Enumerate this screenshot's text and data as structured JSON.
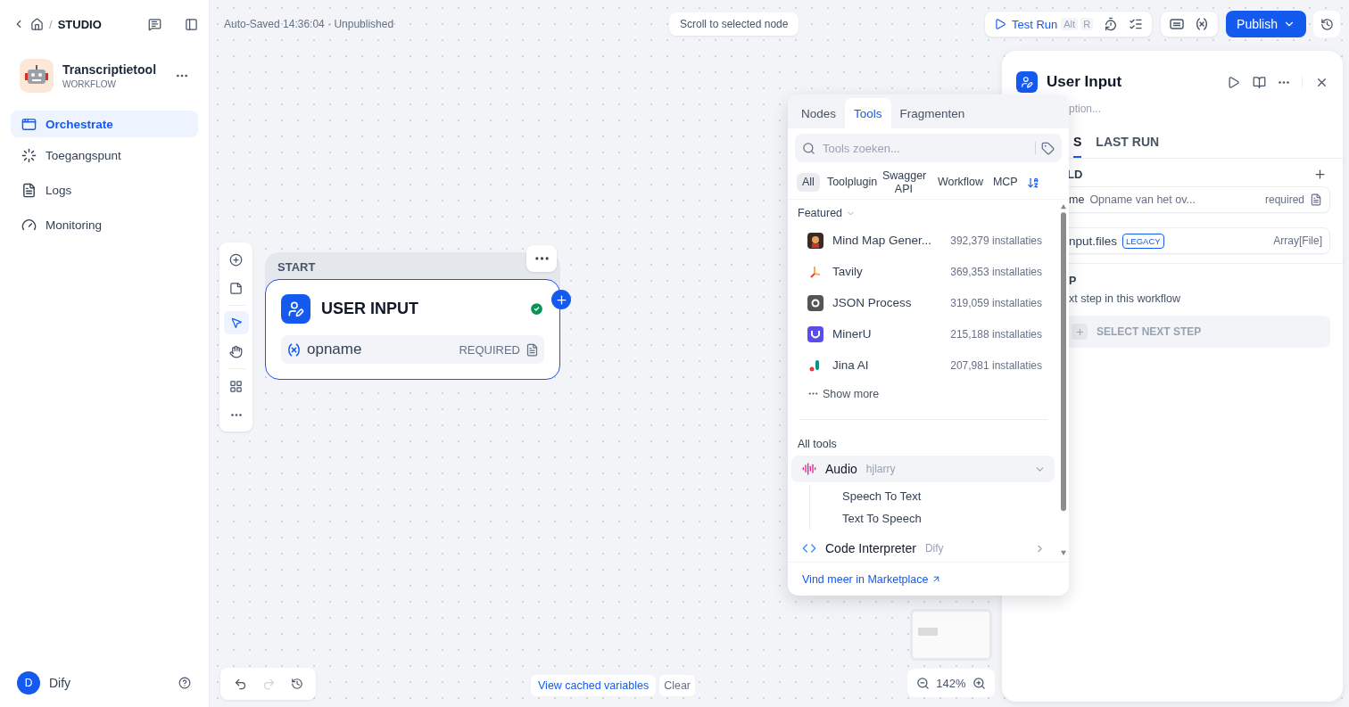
{
  "breadcrumb": {
    "separator": "/",
    "section": "STUDIO"
  },
  "app": {
    "name": "Transcriptietool",
    "type": "WORKFLOW"
  },
  "nav": [
    {
      "label": "Orchestrate",
      "selected": true,
      "kind": "orchestrate"
    },
    {
      "label": "Toegangspunt",
      "selected": false,
      "kind": "access"
    },
    {
      "label": "Logs",
      "selected": false,
      "kind": "logs"
    },
    {
      "label": "Monitoring",
      "selected": false,
      "kind": "monitoring"
    }
  ],
  "user": {
    "initial": "D",
    "name": "Dify"
  },
  "status": "Auto-Saved 14:36:04 · Unpublished",
  "scroll_hint": "Scroll to selected node",
  "toolbar": {
    "test_run": "Test Run",
    "shortcut": [
      "Alt",
      "R"
    ],
    "publish": "Publish"
  },
  "node": {
    "group": "START",
    "title": "USER INPUT",
    "valid": true,
    "variables": [
      {
        "name": "opname",
        "required_label": "REQUIRED"
      }
    ]
  },
  "tools_panel": {
    "tabs": [
      {
        "label": "Nodes",
        "selected": false
      },
      {
        "label": "Tools",
        "selected": true
      },
      {
        "label": "Fragmenten",
        "selected": false
      }
    ],
    "search": {
      "placeholder": "Tools zoeken..."
    },
    "filters": [
      {
        "label": "All",
        "selected": true
      },
      {
        "label": "Toolplugin",
        "selected": false
      },
      {
        "label": "Swagger API",
        "selected": false
      },
      {
        "label": "Workflow",
        "selected": false
      },
      {
        "label": "MCP",
        "selected": false
      }
    ],
    "featured_label": "Featured",
    "featured": [
      {
        "name": "Mind Map Gener...",
        "installs": "392,379 installaties",
        "kind": "mindmap"
      },
      {
        "name": "Tavily",
        "installs": "369,353 installaties",
        "kind": "tavily"
      },
      {
        "name": "JSON Process",
        "installs": "319,059 installaties",
        "kind": "json"
      },
      {
        "name": "MinerU",
        "installs": "215,188 installaties",
        "kind": "mineru"
      },
      {
        "name": "Jina AI",
        "installs": "207,981 installaties",
        "kind": "jina"
      }
    ],
    "show_more": "Show more",
    "all_tools_label": "All tools",
    "providers": [
      {
        "name": "Audio",
        "author": "hjlarry",
        "expanded": true,
        "kind": "audio",
        "tools": [
          "Speech To Text",
          "Text To Speech"
        ]
      },
      {
        "name": "Code Interpreter",
        "author": "Dify",
        "expanded": false,
        "kind": "code"
      }
    ],
    "marketplace_link": "Vind meer in Marketplace"
  },
  "inspector": {
    "title": "User Input",
    "description_placeholder": "ption...",
    "tabs": [
      {
        "label": "S",
        "selected": true
      },
      {
        "label": "LAST RUN",
        "selected": false
      }
    ],
    "fields_heading": "LD",
    "fields": [
      {
        "kind": "text",
        "name": "me",
        "description": "Opname van het ov...",
        "required": "required"
      },
      {
        "kind": "file",
        "name": "nput.files",
        "badge": "LEGACY",
        "type": "Array[File]"
      }
    ],
    "next_step": {
      "heading": "P",
      "description": "xt step in this workflow",
      "button": "SELECT NEXT STEP"
    }
  },
  "zoom": "142%",
  "cache": {
    "view": "View cached variables",
    "clear": "Clear"
  }
}
